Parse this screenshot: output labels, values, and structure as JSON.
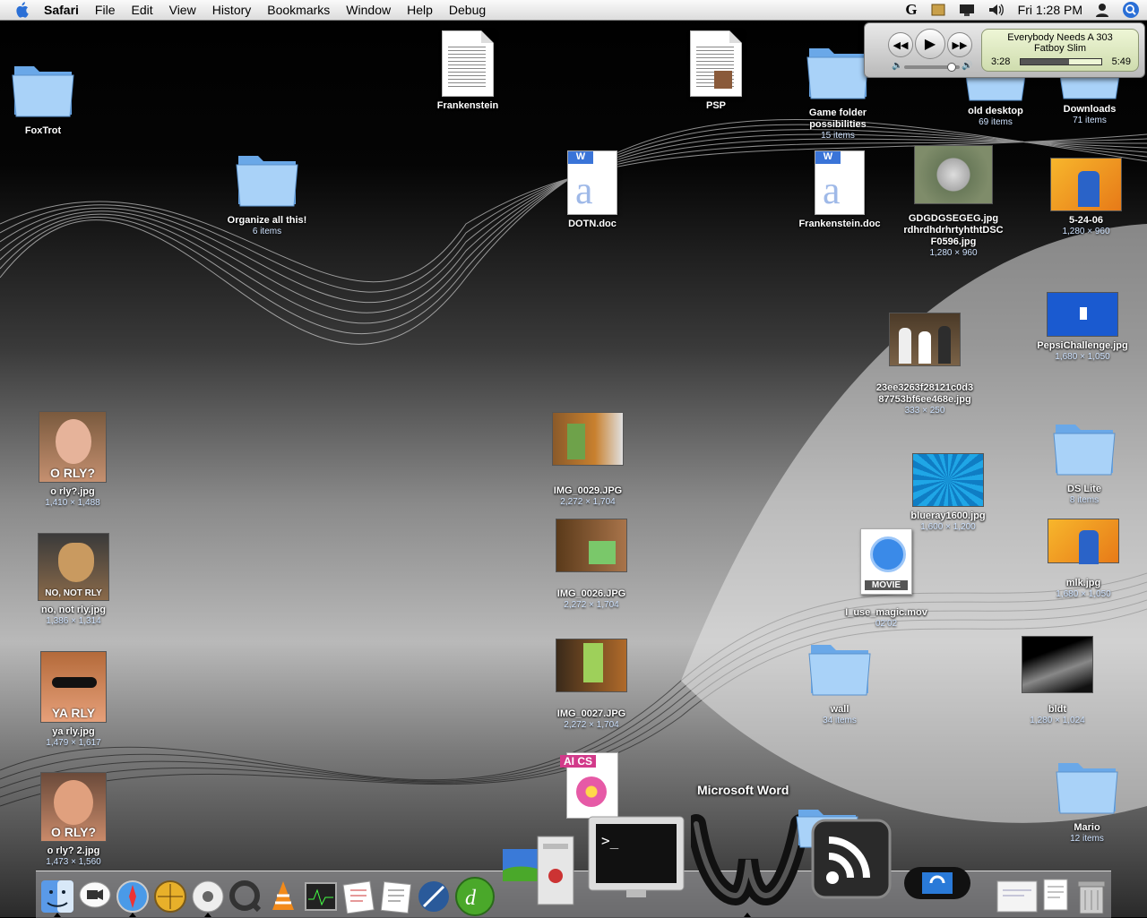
{
  "menubar": {
    "app": "Safari",
    "items": [
      "File",
      "Edit",
      "View",
      "History",
      "Bookmarks",
      "Window",
      "Help",
      "Debug"
    ],
    "clock": "Fri 1:28 PM"
  },
  "itunes": {
    "track": "Everybody Needs A 303",
    "artist": "Fatboy Slim",
    "elapsed": "3:28",
    "total": "5:49",
    "progress": 0.6
  },
  "desktop_icons": {
    "foxtrot": {
      "label": "FoxTrot"
    },
    "frankenstein": {
      "label": "Frankenstein"
    },
    "psp": {
      "label": "PSP"
    },
    "game_folder": {
      "label": "Game folder possibilities",
      "sub": "15 items"
    },
    "old_desktop": {
      "label": "old desktop",
      "sub": "69 items"
    },
    "downloads": {
      "label": "Downloads",
      "sub": "71 items"
    },
    "organize": {
      "label": "Organize all this!",
      "sub": "6 items"
    },
    "dotn": {
      "label": "DOTN.doc"
    },
    "frankenstein_doc": {
      "label": "Frankenstein.doc"
    },
    "cd_jpg": {
      "label": "GDGDGSEGEG.jpg",
      "label2": "rdhrdhdrhrtyhthtDSC",
      "label3": "F0596.jpg",
      "sub": "1,280 × 960"
    },
    "may24": {
      "label": "5-24-06",
      "sub": "1,280 × 960"
    },
    "pepsi": {
      "label": "PepsiChallenge.jpg",
      "sub": "1,680 × 1,050"
    },
    "hash_jpg": {
      "label": "23ee3263f28121c0d3",
      "label2": "87753bf6ee468e.jpg",
      "sub": "333 × 250"
    },
    "orly": {
      "label": "o rly?.jpg",
      "sub": "1,410 × 1,488",
      "caption": "O RLY?"
    },
    "img29": {
      "label": "IMG_0029.JPG",
      "sub": "2,272 × 1,704"
    },
    "dslite": {
      "label": "DS Lite",
      "sub": "8 items"
    },
    "blueray": {
      "label": "blueray1600.jpg",
      "sub": "1,600 × 1,200"
    },
    "nonotrly": {
      "label": "no, not rly.jpg",
      "sub": "1,386 × 1,314",
      "caption": "NO, NOT RLY"
    },
    "img26": {
      "label": "IMG_0026.JPG",
      "sub": "2,272 × 1,704"
    },
    "mlk": {
      "label": "mlk.jpg",
      "sub": "1,680 × 1,050"
    },
    "magic": {
      "label": "I_use_magic.mov",
      "sub": "02'02",
      "badge": "MOVIE"
    },
    "yarly": {
      "label": "ya rly.jpg",
      "sub": "1,479 × 1,617",
      "caption": "YA RLY"
    },
    "img27": {
      "label": "IMG_0027.JPG",
      "sub": "2,272 × 1,704"
    },
    "wall": {
      "label": "wall",
      "sub": "34 items"
    },
    "bldt": {
      "label": "bldt",
      "sub": "1,280 × 1,024"
    },
    "orly2": {
      "label": "o rly? 2.jpg",
      "sub": "1,473 × 1,560",
      "caption": "O RLY?"
    },
    "aics": {
      "badge": "AI CS"
    },
    "mario": {
      "label": "Mario",
      "sub": "12 items"
    }
  },
  "dock": {
    "hover_label": "Microsoft Word",
    "apps": [
      "finder-icon",
      "ichat-icon",
      "safari-icon",
      "camino-icon",
      "itunes-icon",
      "quicktime-icon",
      "vlc-icon",
      "activity-monitor-icon",
      "textedit-icon",
      "preview-icon",
      "omniweb-icon",
      "dreamweaver-icon",
      "virtual-pc-icon",
      "server-icon",
      "terminal-icon",
      "word-icon",
      "rss-icon",
      "psp-sync-icon",
      "desktop-folder-icon",
      "documents-icon",
      "trash-icon"
    ]
  },
  "colors": {
    "folder": "#8fc3f3",
    "menubar": "#e8e8e8",
    "lcd": "#dfe9c4"
  }
}
